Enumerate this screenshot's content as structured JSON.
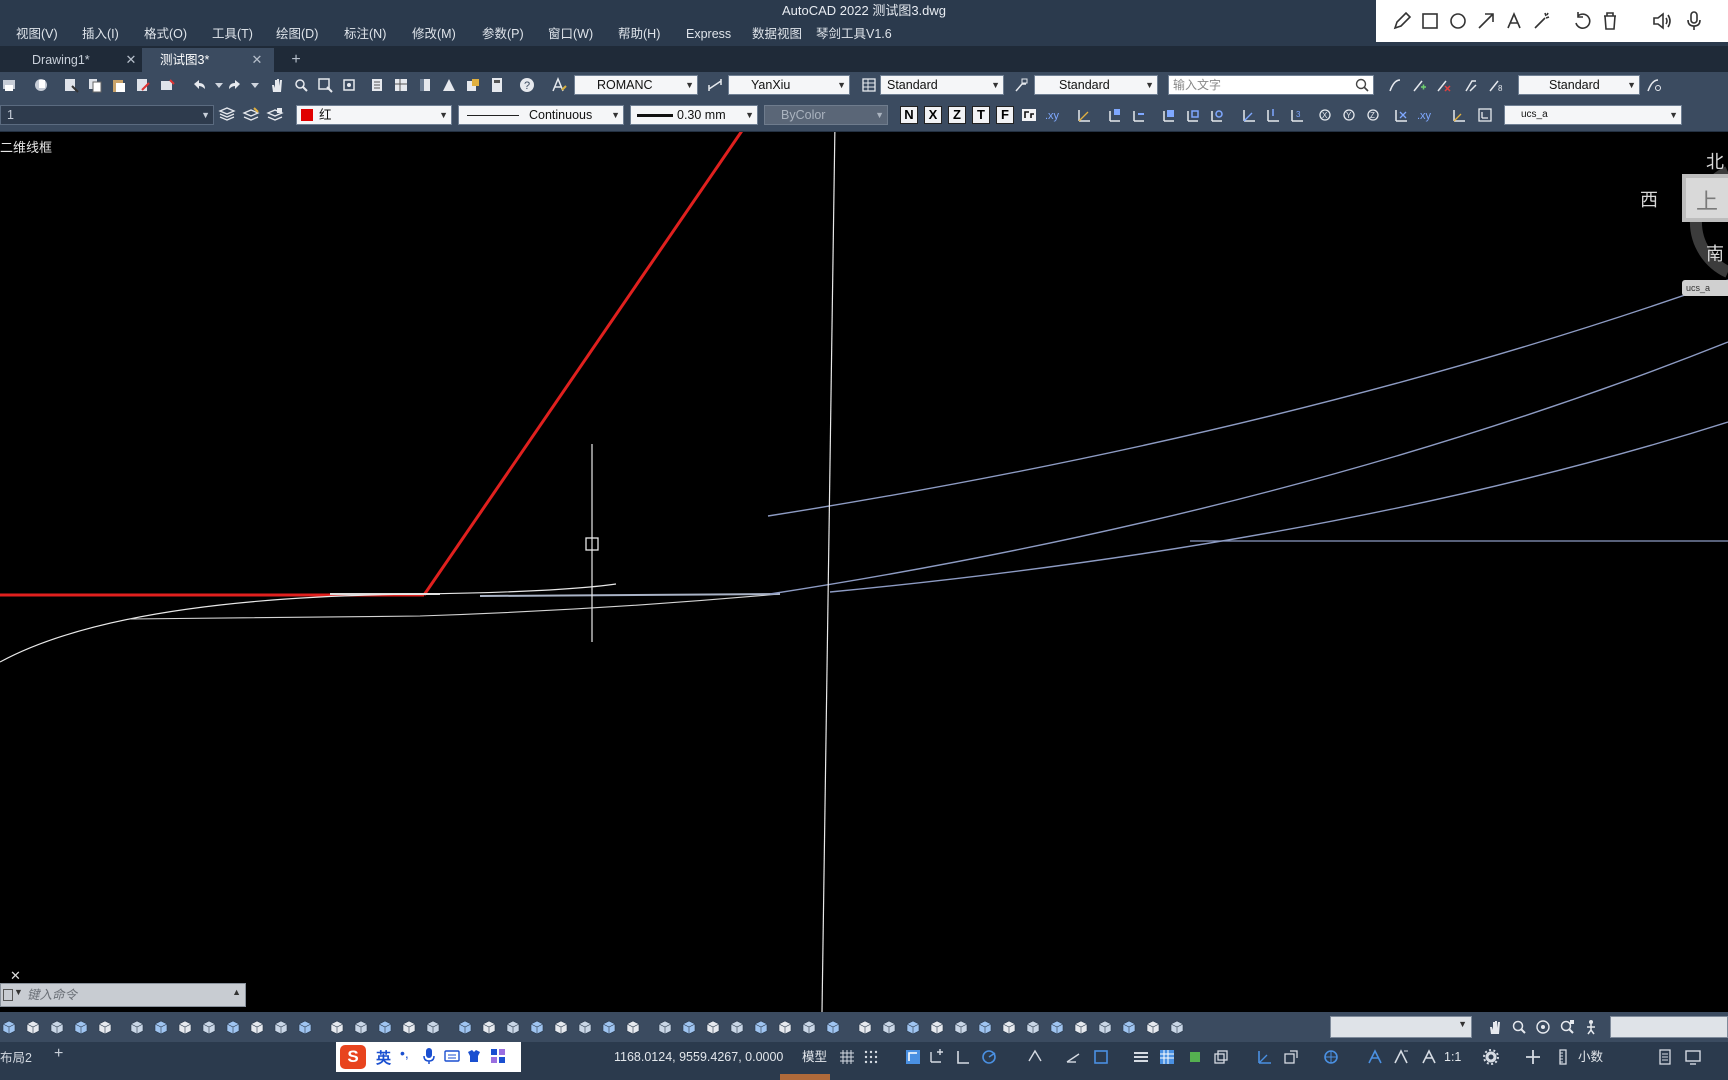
{
  "window": {
    "title": "AutoCAD 2022    测试图3.dwg"
  },
  "menu": {
    "items": [
      "视图(V)",
      "插入(I)",
      "格式(O)",
      "工具(T)",
      "绘图(D)",
      "标注(N)",
      "修改(M)",
      "参数(P)",
      "窗口(W)",
      "帮助(H)",
      "Express",
      "数据视图",
      "琴剑工具V1.6"
    ]
  },
  "tabs": [
    {
      "label": "Drawing1*",
      "close": "✕"
    },
    {
      "label": "测试图3*",
      "close": "✕"
    }
  ],
  "tab_add": "+",
  "toolbar1": {
    "text_style": "ROMANC",
    "dim_style": "YanXiu",
    "table_style": "Standard",
    "multileader_style": "Standard",
    "search_placeholder": "输入文字",
    "style_right": "Standard"
  },
  "toolbar2": {
    "layer": "1",
    "color_name": "红",
    "color_swatch": "#e00000",
    "linetype": "Continuous",
    "lineweight": "0.30 mm",
    "plotstyle": "ByColor",
    "ucs_name": "ucs_a",
    "text_buttons": [
      "N",
      "X",
      "Z",
      "T",
      "F"
    ]
  },
  "canvas": {
    "view_label": "二维线框",
    "compass": {
      "north": "北",
      "south": "南",
      "west": "西",
      "top": "上"
    },
    "ucs_badge": "ucs_a",
    "colors": {
      "red_line": "#e0201e",
      "curve": "#8d9bc3",
      "white": "#e8e8e8"
    }
  },
  "command_line": {
    "placeholder": "键入命令",
    "close": "✕"
  },
  "status": {
    "layout_tab": "布局2",
    "layout_add": "+",
    "coords": "1168.0124, 9559.4267, 0.0000",
    "model": "模型",
    "scale": "1:1",
    "units": "小数",
    "ime_label": "英"
  }
}
